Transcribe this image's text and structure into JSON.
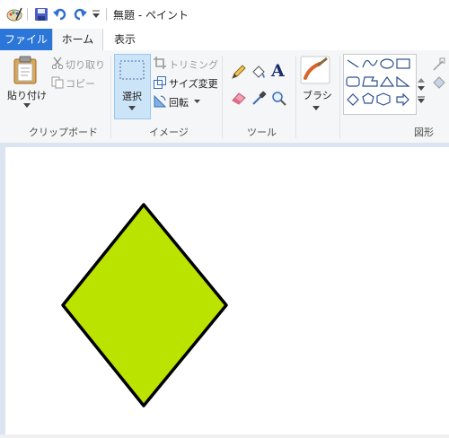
{
  "window": {
    "title": "無題 - ペイント"
  },
  "quick_access": {
    "icons": [
      "paint-app-icon",
      "save-icon",
      "undo-icon",
      "redo-icon",
      "customize-dropdown-icon"
    ]
  },
  "tabs": [
    {
      "label": "ファイル"
    },
    {
      "label": "ホーム"
    },
    {
      "label": "表示"
    }
  ],
  "clipboard": {
    "paste_label": "貼り付け",
    "cut_label": "切り取り",
    "copy_label": "コピー",
    "group_label": "クリップボード"
  },
  "image": {
    "select_label": "選択",
    "crop_label": "トリミング",
    "resize_label": "サイズ変更",
    "rotate_label": "回転",
    "group_label": "イメージ"
  },
  "tools": {
    "text_glyph": "A",
    "group_label": "ツール"
  },
  "brushes": {
    "label": "ブラシ"
  },
  "shapes": {
    "group_label": "図形"
  },
  "colors": {
    "titlebar_bg": "#ffffff",
    "file_tab_bg": "#2b76d8",
    "ribbon_bg": "#f5f6f7",
    "workspace_bg": "#dbe4f1",
    "canvas_bg": "#ffffff",
    "diamond_fill": "#bbe300",
    "diamond_stroke": "#000000"
  }
}
